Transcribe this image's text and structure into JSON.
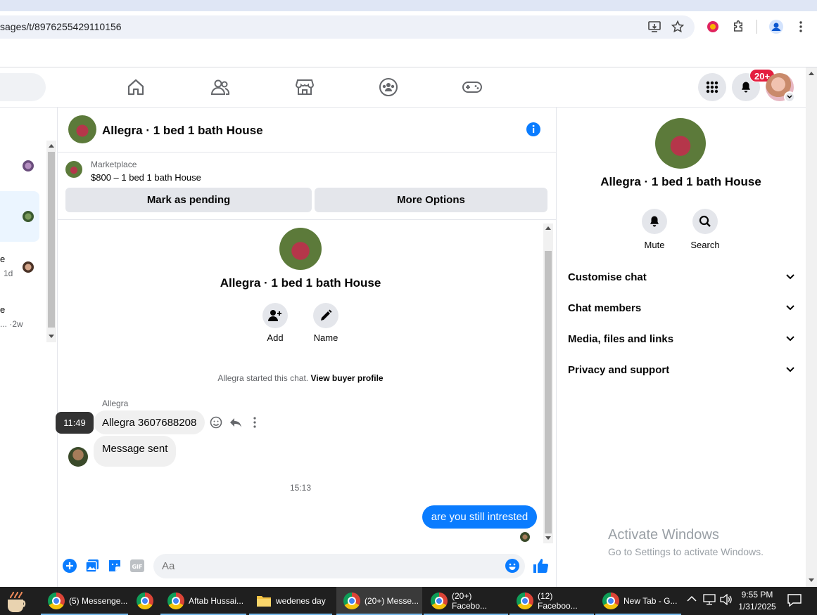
{
  "browser": {
    "url": "sages/t/8976255429110156"
  },
  "fb_header": {
    "notifications_badge": "20+"
  },
  "left_list": {
    "items": [
      {
        "suffix": ""
      },
      {
        "suffix": ""
      },
      {
        "suffix": "1d",
        "edge": "e"
      },
      {
        "suffix": "·2w",
        "edge": "e",
        "prefix": "..."
      }
    ]
  },
  "chat": {
    "title": "Allegra · 1 bed 1 bath House",
    "marketplace_label": "Marketplace",
    "listing": "$800 – 1 bed 1 bath House",
    "mark_pending": "Mark as pending",
    "more_options": "More Options",
    "conv_title": "Allegra · 1 bed 1 bath House",
    "add_label": "Add",
    "name_label": "Name",
    "started_text": "Allegra started this chat.",
    "buyer_profile": "View buyer profile",
    "sender_name": "Allegra",
    "msg1": "Allegra 3607688208",
    "msg1_time": "11:49",
    "msg2": "Message sent",
    "divider_time": "15:13",
    "msg3": "are you still intrested",
    "input_placeholder": "Aa"
  },
  "right_panel": {
    "title": "Allegra · 1 bed 1 bath House",
    "mute": "Mute",
    "search": "Search",
    "rows": [
      "Customise chat",
      "Chat members",
      "Media, files and links",
      "Privacy and support"
    ]
  },
  "watermark": {
    "title": "Activate Windows",
    "subtitle": "Go to Settings to activate Windows."
  },
  "taskbar": {
    "items": [
      "(5) Messenge...",
      "",
      "Aftab Hussai...",
      "wedenes day",
      "(20+) Messe...",
      "(20+) Facebo...",
      "(12) Faceboo...",
      "New Tab - G..."
    ],
    "time": "9:55 PM",
    "date": "1/31/2025"
  },
  "colors": {
    "accent": "#0a7cff",
    "badge": "#e41e3f"
  }
}
